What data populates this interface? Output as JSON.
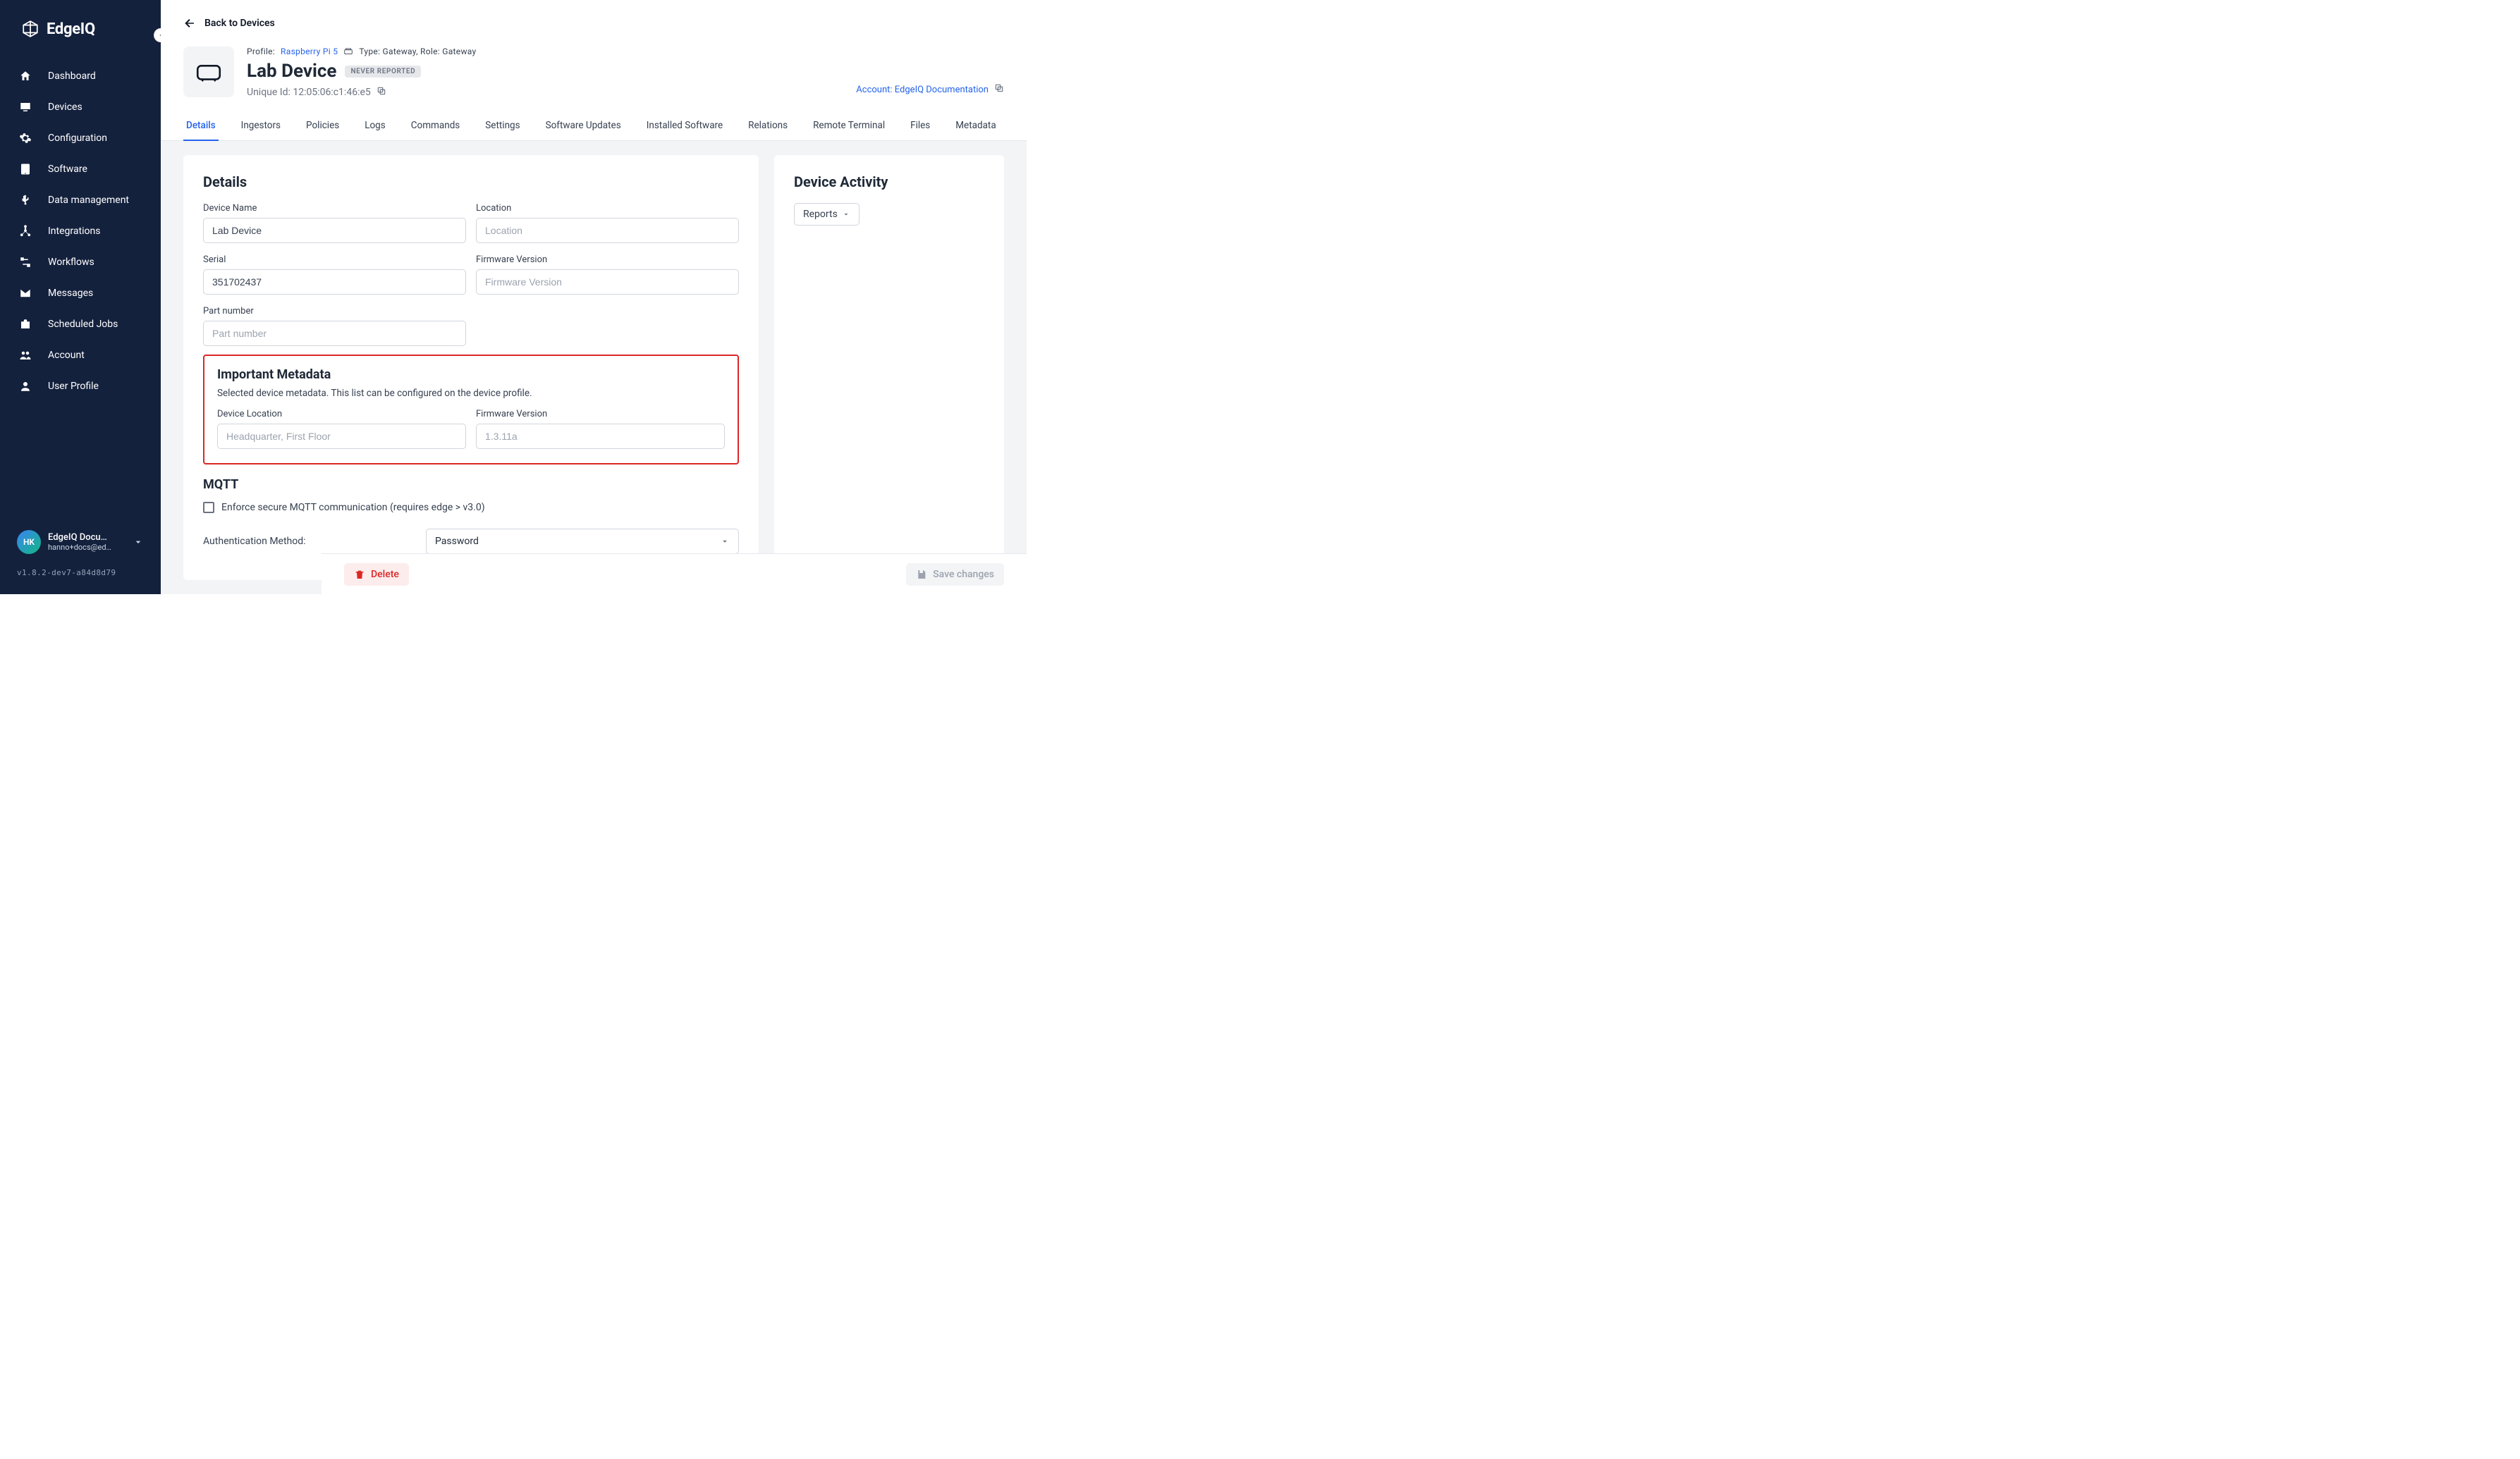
{
  "brand": {
    "name": "EdgeIQ"
  },
  "sidebar": {
    "items": [
      {
        "label": "Dashboard"
      },
      {
        "label": "Devices"
      },
      {
        "label": "Configuration"
      },
      {
        "label": "Software"
      },
      {
        "label": "Data management"
      },
      {
        "label": "Integrations"
      },
      {
        "label": "Workflows"
      },
      {
        "label": "Messages"
      },
      {
        "label": "Scheduled Jobs"
      },
      {
        "label": "Account"
      },
      {
        "label": "User Profile"
      }
    ],
    "user": {
      "initials": "HK",
      "name": "EdgeIQ Docu…",
      "email": "hanno+docs@ed…"
    },
    "version": "v1.8.2-dev7-a84d8d79"
  },
  "header": {
    "back_label": "Back to Devices",
    "profile_label": "Profile:",
    "profile_link": "Raspberry Pi 5",
    "type_role": "Type: Gateway, Role: Gateway",
    "title": "Lab Device",
    "status": "NEVER REPORTED",
    "uid_label": "Unique Id: 12:05:06:c1:46:e5",
    "account_link": "Account: EdgeIQ Documentation"
  },
  "tabs": [
    "Details",
    "Ingestors",
    "Policies",
    "Logs",
    "Commands",
    "Settings",
    "Software Updates",
    "Installed Software",
    "Relations",
    "Remote Terminal",
    "Files",
    "Metadata"
  ],
  "details": {
    "section_title": "Details",
    "device_name": {
      "label": "Device Name",
      "value": "Lab Device"
    },
    "location": {
      "label": "Location",
      "placeholder": "Location",
      "value": ""
    },
    "serial": {
      "label": "Serial",
      "value": "351702437"
    },
    "firmware": {
      "label": "Firmware Version",
      "placeholder": "Firmware Version",
      "value": ""
    },
    "part_number": {
      "label": "Part number",
      "placeholder": "Part number",
      "value": ""
    }
  },
  "important": {
    "title": "Important Metadata",
    "desc": "Selected device metadata. This list can be configured on the device profile.",
    "device_location": {
      "label": "Device Location",
      "value": "Headquarter, First Floor"
    },
    "firmware": {
      "label": "Firmware Version",
      "value": "1.3.11a"
    }
  },
  "mqtt": {
    "title": "MQTT",
    "checkbox_label": "Enforce secure MQTT communication (requires edge > v3.0)",
    "auth_label": "Authentication Method:",
    "auth_value": "Password"
  },
  "activity": {
    "title": "Device Activity",
    "reports_label": "Reports"
  },
  "footer": {
    "delete_label": "Delete",
    "save_label": "Save changes"
  }
}
